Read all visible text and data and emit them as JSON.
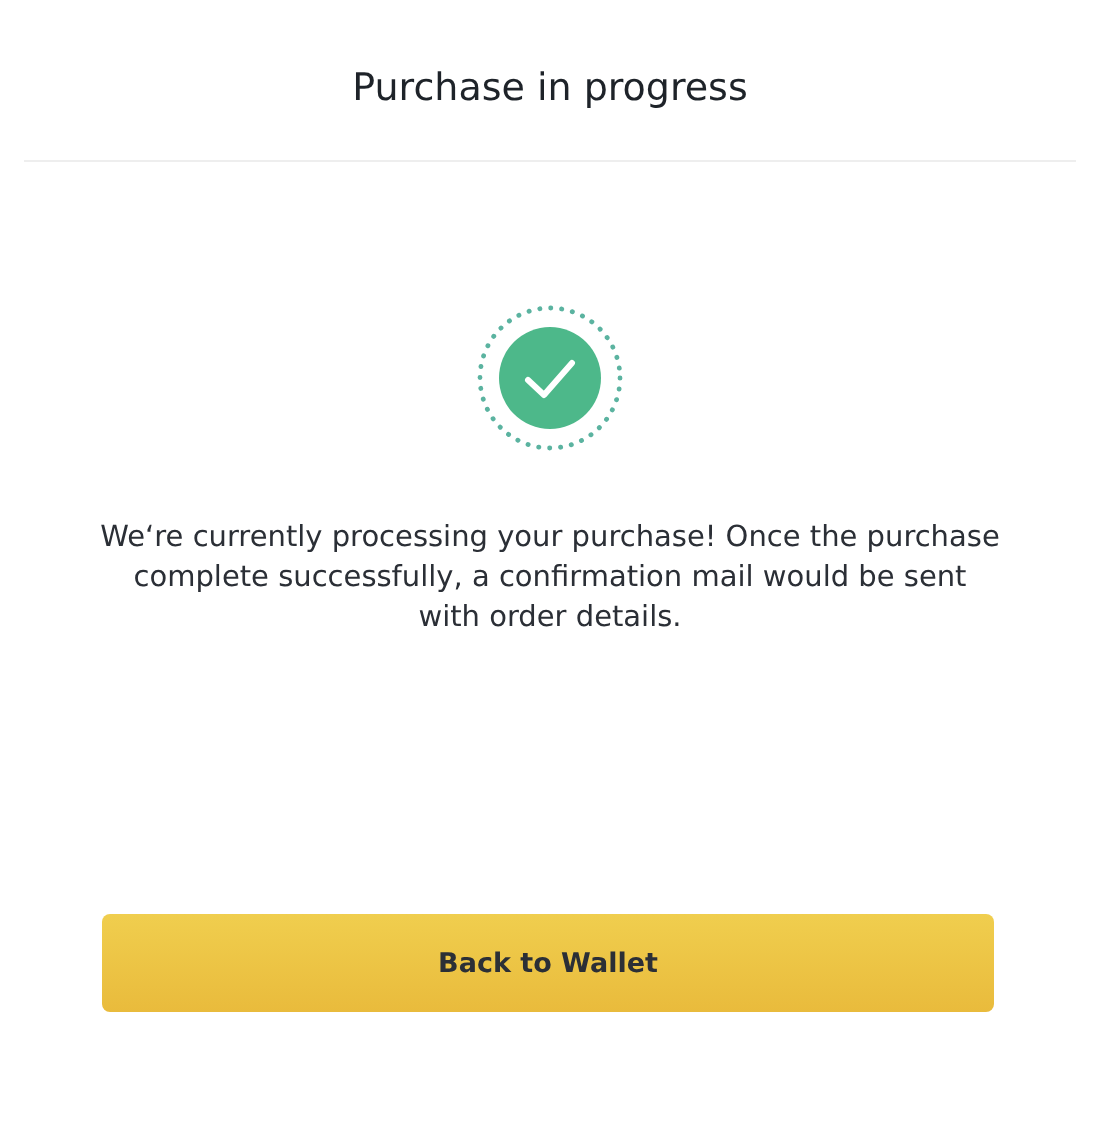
{
  "header": {
    "title": "Purchase in progress"
  },
  "status": {
    "kind": "success"
  },
  "message": "We‘re currently processing your purchase! Once the purchase complete successfully, a confirmation mail would be sent with order details.",
  "buttons": [
    {
      "label": "Back to Wallet"
    }
  ]
}
